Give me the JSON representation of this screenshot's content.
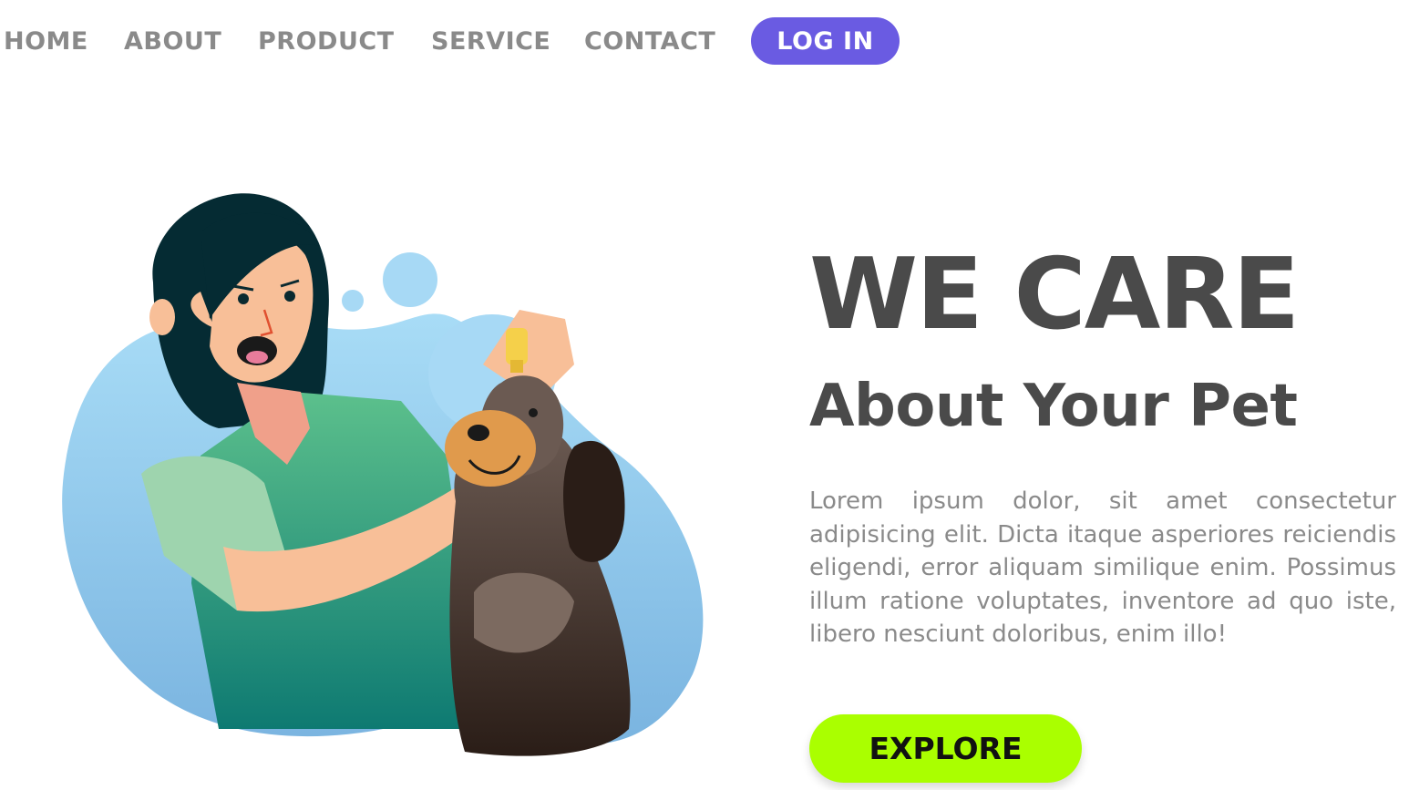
{
  "nav": {
    "items": [
      {
        "label": "HOME"
      },
      {
        "label": "ABOUT"
      },
      {
        "label": "PRODUCT"
      },
      {
        "label": "SERVICE"
      },
      {
        "label": "CONTACT"
      }
    ],
    "login_label": "LOG IN"
  },
  "hero": {
    "title": "WE CARE",
    "subtitle": "About Your Pet",
    "paragraph": "Lorem ipsum dolor, sit amet consectetur adipisicing elit. Dicta itaque asperiores reiciendis eligendi, error aliquam similique enim. Possimus illum ratione voluptates, inventore ad quo iste, libero nesciunt doloribus, enim illo!",
    "cta_label": "EXPLORE"
  },
  "colors": {
    "nav_text": "#8a8a8a",
    "login_bg": "#6a5be2",
    "heading": "#4a4a4a",
    "body_text": "#8a8a8a",
    "cta_bg": "#aaff00",
    "blob": "#8cc8ee"
  },
  "illustration": {
    "subject": "woman giving eye drops to dog",
    "icons": [
      "woman-figure",
      "dog-figure",
      "eye-dropper-icon",
      "blob-background"
    ]
  }
}
